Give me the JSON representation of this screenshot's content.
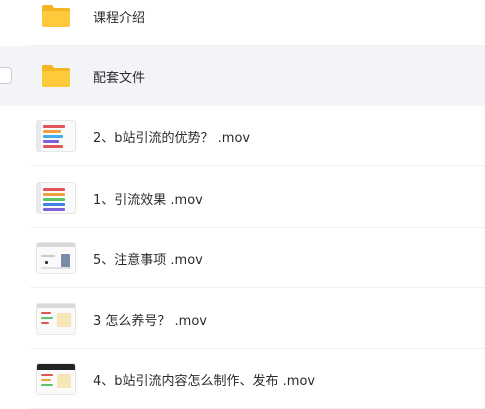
{
  "files": [
    {
      "name": "课程介绍",
      "type": "folder"
    },
    {
      "name": "配套文件",
      "type": "folder",
      "selected": true
    },
    {
      "name": "2、b站引流的优势？ .mov",
      "type": "video"
    },
    {
      "name": "1、引流效果 .mov",
      "type": "video"
    },
    {
      "name": "5、注意事项 .mov",
      "type": "video"
    },
    {
      "name": "3 怎么养号？ .mov",
      "type": "video"
    },
    {
      "name": "4、b站引流内容怎么制作、发布 .mov",
      "type": "video"
    }
  ],
  "icons": {
    "folder": "folder-icon",
    "video": "video-thumbnail-icon"
  },
  "colors": {
    "folder": "#ffc93c",
    "folder_tab": "#f5b625",
    "selected_row": "#f3f4f8",
    "divider": "#eef0f4"
  }
}
